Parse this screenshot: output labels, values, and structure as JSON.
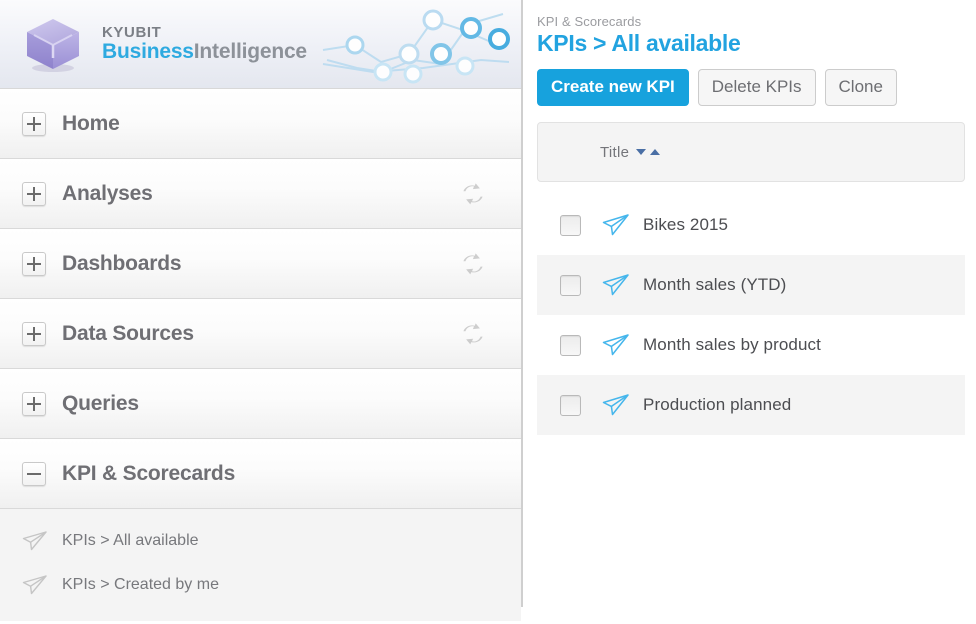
{
  "brand": {
    "name_line1": "KYUBIT",
    "name_line2_bold": "Business",
    "name_line2_rest": "Intelligence",
    "logo_icon": "cube-icon",
    "graphic_icon": "network-chart-icon",
    "accent_color": "#2eaae0",
    "muted_color": "#8d9299"
  },
  "sidebar": {
    "groups": [
      {
        "label": "Home",
        "state": "collapsed",
        "toggle_glyph": "+",
        "has_refresh": false,
        "refresh_icon": "refresh-icon"
      },
      {
        "label": "Analyses",
        "state": "collapsed",
        "toggle_glyph": "+",
        "has_refresh": true,
        "refresh_icon": "refresh-icon"
      },
      {
        "label": "Dashboards",
        "state": "collapsed",
        "toggle_glyph": "+",
        "has_refresh": true,
        "refresh_icon": "refresh-icon"
      },
      {
        "label": "Data Sources",
        "state": "collapsed",
        "toggle_glyph": "+",
        "has_refresh": true,
        "refresh_icon": "refresh-icon"
      },
      {
        "label": "Queries",
        "state": "collapsed",
        "toggle_glyph": "+",
        "has_refresh": false,
        "refresh_icon": "refresh-icon"
      },
      {
        "label": "KPI & Scorecards",
        "state": "expanded",
        "toggle_glyph": "-",
        "has_refresh": false,
        "refresh_icon": "refresh-icon"
      }
    ],
    "subitems": [
      {
        "label": "KPIs > All available",
        "icon": "paper-plane-icon",
        "selected": true
      },
      {
        "label": "KPIs > Created by me",
        "icon": "paper-plane-icon",
        "selected": false
      }
    ]
  },
  "main": {
    "breadcrumb": "KPI & Scorecards",
    "title": "KPIs > All available",
    "title_color": "#22a3e0",
    "toolbar": {
      "create_label": "Create new KPI",
      "delete_label": "Delete KPIs",
      "clone_label": "Clone",
      "primary_color": "#17a2dd"
    },
    "table": {
      "columns": [
        {
          "label": "Title",
          "sortable": true,
          "sort_down_icon": "sort-descending-icon",
          "sort_up_icon": "sort-ascending-icon"
        }
      ],
      "rows": [
        {
          "title": "Bikes 2015",
          "checked": false,
          "icon": "paper-plane-icon"
        },
        {
          "title": "Month sales (YTD)",
          "checked": false,
          "icon": "paper-plane-icon"
        },
        {
          "title": "Month sales by product",
          "checked": false,
          "icon": "paper-plane-icon"
        },
        {
          "title": "Production planned",
          "checked": false,
          "icon": "paper-plane-icon"
        }
      ]
    }
  }
}
